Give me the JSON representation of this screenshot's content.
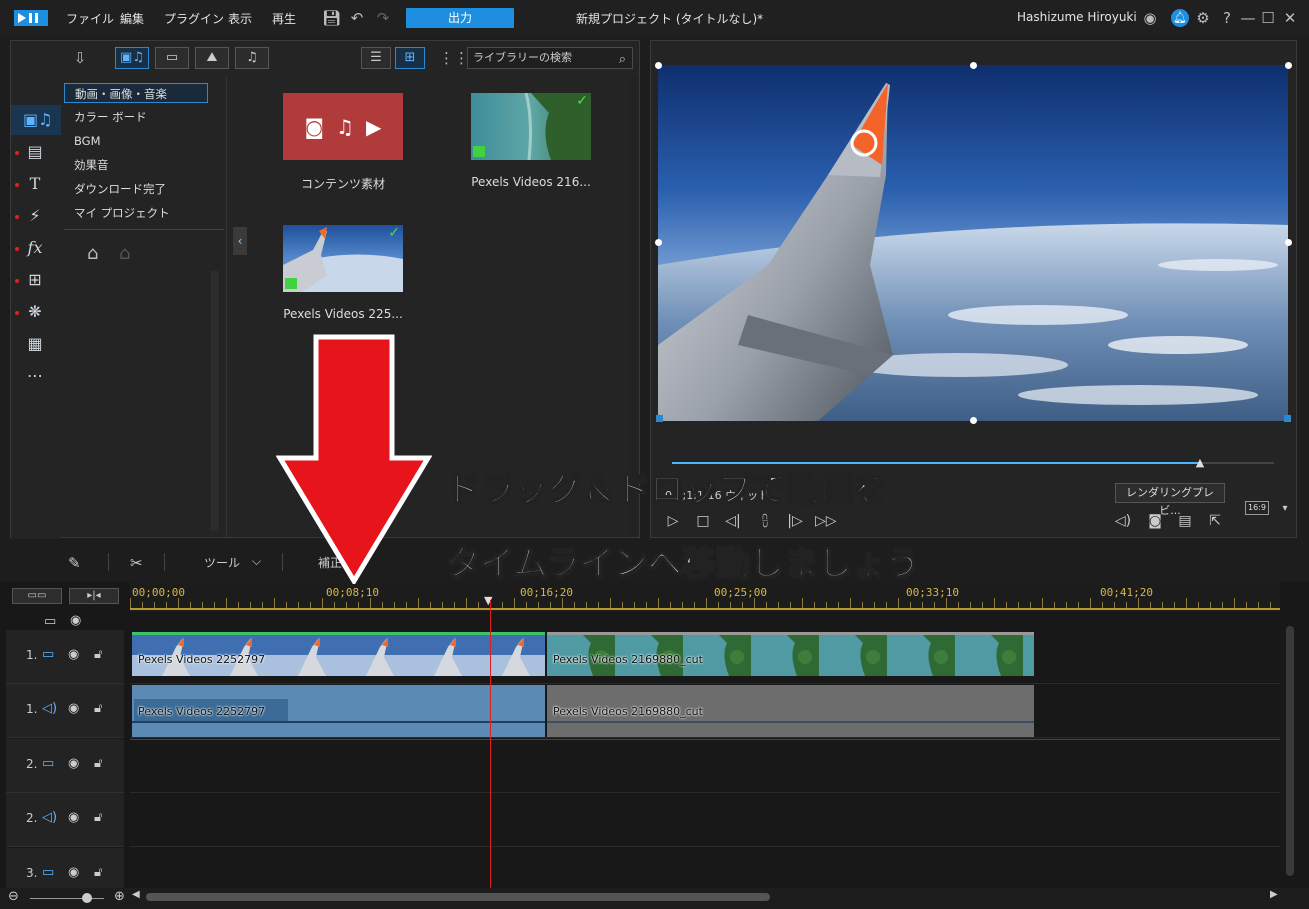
{
  "titlebar": {
    "menus": [
      "ファイル",
      "編集",
      "プラグイン",
      "表示",
      "再生"
    ],
    "output_label": "出力",
    "project_title": "新規プロジェクト (タイトルなし)*",
    "user_name": "Hashizume Hiroyuki"
  },
  "library": {
    "search_placeholder": "ライブラリーの検索",
    "categories": [
      "動画・画像・音楽",
      "カラー ボード",
      "BGM",
      "効果音",
      "ダウンロード完了",
      "マイ プロジェクト"
    ],
    "items": [
      {
        "label": "コンテンツ素材",
        "kind": "content"
      },
      {
        "label": "Pexels Videos 216...",
        "kind": "aerial"
      },
      {
        "label": "Pexels Videos 225...",
        "kind": "wing"
      }
    ]
  },
  "preview": {
    "time_readout": "0...;1;1;16  ウィット",
    "render_label": "レンダリングプレビ...",
    "aspect_label": "16:9",
    "progress": 0.88
  },
  "edit_bar": {
    "tools_label": "ツール",
    "correct_label": "補正 / 調"
  },
  "timeline": {
    "ruler_labels": [
      "00;00;00",
      "00;08;10",
      "00;16;20",
      "00;25;00",
      "00;33;10",
      "00;41;20"
    ],
    "tracks": [
      {
        "num": "1.",
        "type": "video"
      },
      {
        "num": "1.",
        "type": "audio"
      },
      {
        "num": "2.",
        "type": "video"
      },
      {
        "num": "2.",
        "type": "audio"
      },
      {
        "num": "3.",
        "type": "video"
      }
    ],
    "clips": {
      "video_a": "Pexels Videos 2252797",
      "video_b": "Pexels Videos 2169880_cut",
      "audio_a": "Pexels Videos 2252797",
      "audio_b": "Pexels Videos 2169880_cut"
    }
  },
  "annotation": {
    "line1": "ドラッグ＆ドロップで動画を",
    "line2": "タイムラインへ移動しましょう"
  },
  "colors": {
    "accent": "#1e8fe0",
    "arrow": "#e8141c",
    "playhead": "#e02020"
  }
}
